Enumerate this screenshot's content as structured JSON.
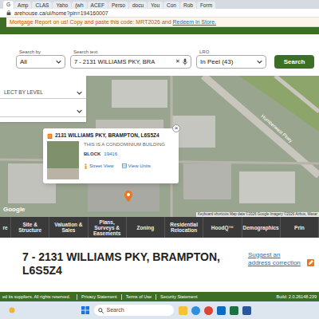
{
  "browser": {
    "tabs": [
      {
        "label": "G",
        "selected": true
      },
      {
        "label": "Amp",
        "selected": false
      },
      {
        "label": "CLAS",
        "selected": false
      },
      {
        "label": "Yaho",
        "selected": false
      },
      {
        "label": "(wh",
        "selected": false
      },
      {
        "label": "ACEF",
        "selected": false
      },
      {
        "label": "Perso",
        "selected": false
      },
      {
        "label": "docu",
        "selected": false
      },
      {
        "label": "You",
        "selected": false
      },
      {
        "label": "Con",
        "selected": false
      },
      {
        "label": "Rob",
        "selected": false
      },
      {
        "label": "Form",
        "selected": false
      }
    ],
    "address": "arehouse.ca/ui/home?pin=194160007"
  },
  "promo": {
    "text": "Mortgage Report on us! Copy and paste this code: MRT2026 and ",
    "link": "Redeem in Store."
  },
  "search": {
    "search_by_label": "Search by",
    "search_by": "All",
    "text_label": "Search text",
    "text": "7 - 2131 WILLIAMS PKY, BRA",
    "clear": "✕",
    "lro_label": "LRO",
    "lro": "In Peel (43)",
    "button": "Search"
  },
  "side_panel": {
    "dropdown": "LECT BY LEVEL"
  },
  "popup": {
    "title": "2131 WILLIAMS PKY, BRAMPTON, L6S5Z4",
    "subtitle": "THIS IS A CONDOMINIUM BUILDING",
    "block_label": "BLOCK",
    "block": "19416",
    "street_view": "Street View",
    "view_units": "View Units",
    "close": "×"
  },
  "map": {
    "labels": [
      "Humberwest Pkwy"
    ],
    "logo": "Google",
    "attribution": "Keyboard shortcuts  Map data ©2026 Google Imagery ©2026 Airbus, Maxar"
  },
  "nav": {
    "items": [
      "re",
      "Site & Structure",
      "Valuation & Sales",
      "Plans, Surveys & Easements",
      "Zoning",
      "Residential Relocation",
      "HoodQ™",
      "Demographics",
      "Prin"
    ]
  },
  "property": {
    "title": "7 - 2131 WILLIAMS PKY, BRAMPTON, L6S5Z4",
    "suggest": "Suggest an address correction"
  },
  "footer": {
    "text": "ed its suppliers. All rights reserved.",
    "links": [
      "Privacy Statement",
      "Terms of Use",
      "Security Statement"
    ],
    "build": "Build: 2.0.26148.239"
  },
  "taskbar": {
    "search": "Search"
  }
}
